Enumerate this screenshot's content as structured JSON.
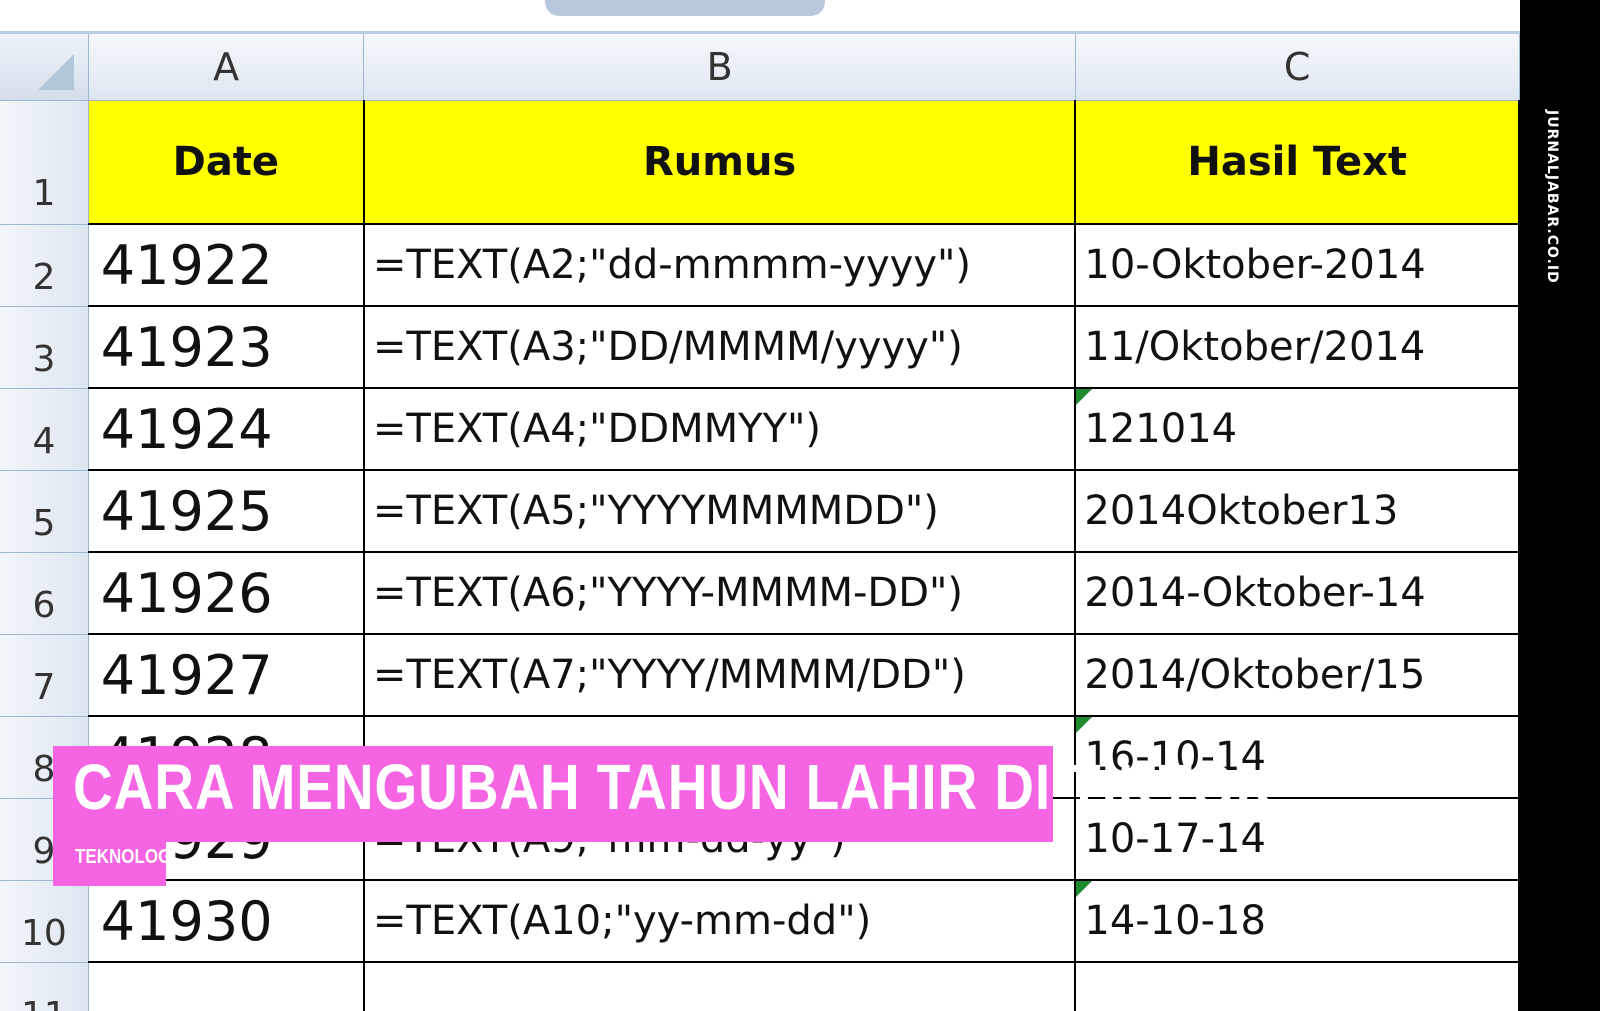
{
  "spreadsheet": {
    "columns": [
      "A",
      "B",
      "C"
    ],
    "header_row": {
      "row_number": "1",
      "cells": [
        "Date",
        "Rumus",
        "Hasil Text"
      ]
    },
    "rows": [
      {
        "row_number": "2",
        "date": "41922",
        "formula": "=TEXT(A2;\"dd-mmmm-yyyy\")",
        "result": "10-Oktober-2014"
      },
      {
        "row_number": "3",
        "date": "41923",
        "formula": "=TEXT(A3;\"DD/MMMM/yyyy\")",
        "result": "11/Oktober/2014"
      },
      {
        "row_number": "4",
        "date": "41924",
        "formula": "=TEXT(A4;\"DDMMYY\")",
        "result": "121014"
      },
      {
        "row_number": "5",
        "date": "41925",
        "formula": "=TEXT(A5;\"YYYYMMMMDD\")",
        "result": "2014Oktober13"
      },
      {
        "row_number": "6",
        "date": "41926",
        "formula": "=TEXT(A6;\"YYYY-MMMM-DD\")",
        "result": "2014-Oktober-14"
      },
      {
        "row_number": "7",
        "date": "41927",
        "formula": "=TEXT(A7;\"YYYY/MMMM/DD\")",
        "result": "2014/Oktober/15"
      },
      {
        "row_number": "8",
        "date": "41928",
        "formula": "",
        "result": "16-10-14"
      },
      {
        "row_number": "9",
        "date": "41929",
        "formula": "=TEXT(A9;\"mm-dd-yy\")",
        "result": "10-17-14"
      },
      {
        "row_number": "10",
        "date": "41930",
        "formula": "=TEXT(A10;\"yy-mm-dd\")",
        "result": "14-10-18"
      },
      {
        "row_number": "11",
        "date": "",
        "formula": "",
        "result": ""
      }
    ]
  },
  "overlay": {
    "title": "CARA MENGUBAH TAHUN LAHIR DI TIKTOK",
    "category": "TEKNOLOGI"
  },
  "watermark": "JURNALJABAR.CO.ID",
  "colors": {
    "header_fill": "#ffff00",
    "banner": "#f564e3",
    "sidebar": "#000000",
    "error_flag": "#1e8a2e"
  }
}
